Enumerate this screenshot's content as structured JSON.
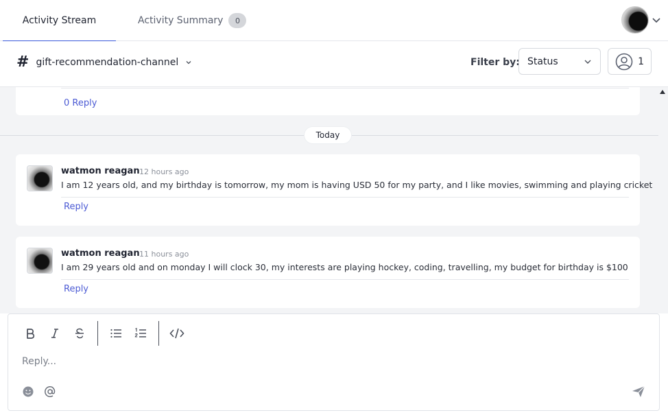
{
  "tabs": [
    {
      "label": "Activity Stream",
      "active": true
    },
    {
      "label": "Activity Summary",
      "badge": "0",
      "active": false
    }
  ],
  "profile": {
    "avatar_icon": "user-avatar",
    "menu_icon": "chevron-down-icon"
  },
  "channel": {
    "icon": "hash-icon",
    "name": "gift-recommendation-channel"
  },
  "filter": {
    "label": "Filter by:",
    "selected": "Status"
  },
  "members": {
    "count": "1"
  },
  "previous_message": {
    "reply_label": "0 Reply"
  },
  "date_divider": "Today",
  "messages": [
    {
      "author": "watmon reagan",
      "time": "12 hours ago",
      "text": "I am 12 years old, and my birthday is tomorrow, my mom is having USD 50 for my party, and I like movies, swimming and playing cricket",
      "reply_label": "Reply"
    },
    {
      "author": "watmon reagan",
      "time": "11 hours ago",
      "text": "I am 29 years old and on monday I will clock 30, my interests are playing hockey, coding, travelling, my budget for birthday is $100",
      "reply_label": "Reply"
    }
  ],
  "composer": {
    "placeholder": "Reply...",
    "toolbar": [
      "bold-icon",
      "italic-icon",
      "strikethrough-icon",
      "bullet-list-icon",
      "numbered-list-icon",
      "code-icon"
    ],
    "bottom": [
      "emoji-icon",
      "mention-icon"
    ],
    "send_icon": "send-icon"
  },
  "colors": {
    "accent": "#3b5bdb",
    "link": "#4c5bd4",
    "feed_bg": "#f3f4f6"
  }
}
